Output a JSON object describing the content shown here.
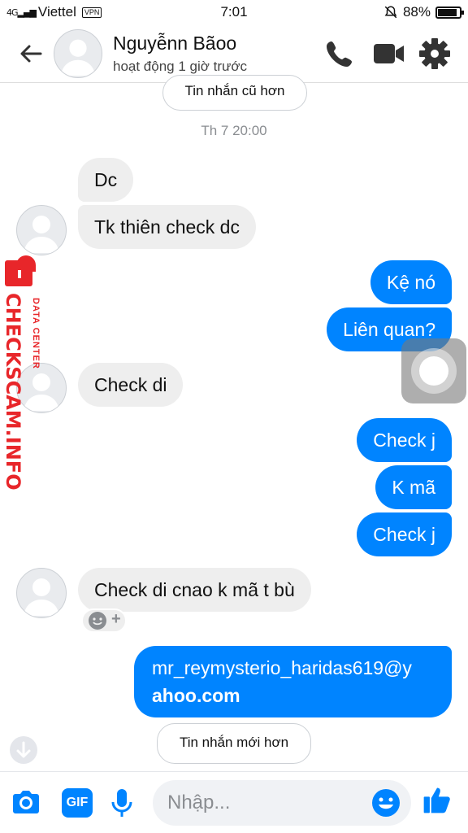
{
  "status_bar": {
    "carrier": "Viettel",
    "vpn": "VPN",
    "time": "7:01",
    "battery": "88%",
    "battery_level": 0.88
  },
  "header": {
    "contact_name": "Nguyễnn Bãoo",
    "contact_status": "hoạt động 1 giờ trước",
    "icons": [
      "back-arrow-icon",
      "phone-icon",
      "video-camera-icon",
      "gear-icon"
    ]
  },
  "chat": {
    "older_button": "Tin nhắn cũ hơn",
    "timestamp": "Th 7 20:00",
    "messages": [
      {
        "from": "them",
        "text": "Dc"
      },
      {
        "from": "them",
        "text": "Tk thiên check dc"
      },
      {
        "from": "me",
        "text": "Kệ nó"
      },
      {
        "from": "me",
        "text": "Liên quan?"
      },
      {
        "from": "them",
        "text": "Check di"
      },
      {
        "from": "me",
        "text": "Check j"
      },
      {
        "from": "me",
        "text": "K mã"
      },
      {
        "from": "me",
        "text": "Check j"
      },
      {
        "from": "them",
        "text": "Check di cnao k mã t bù"
      },
      {
        "from": "me",
        "text_line1": "mr_reymysterio_haridas619@y",
        "text_line2": "ahoo.com"
      }
    ],
    "reaction_add": "+",
    "newer_button": "Tin nhắn mới hơn"
  },
  "watermark": {
    "brand": "CHECKSCAM.INFO",
    "sub": "DATA CENTER"
  },
  "composer": {
    "placeholder": "Nhập...",
    "gif_label": "GIF",
    "icons": [
      "camera-icon",
      "gif-icon",
      "microphone-icon",
      "emoji-icon",
      "thumbs-up-icon"
    ]
  },
  "colors": {
    "accent": "#0084ff",
    "incoming_bubble": "#eeeeee",
    "watermark": "#e8262a"
  }
}
